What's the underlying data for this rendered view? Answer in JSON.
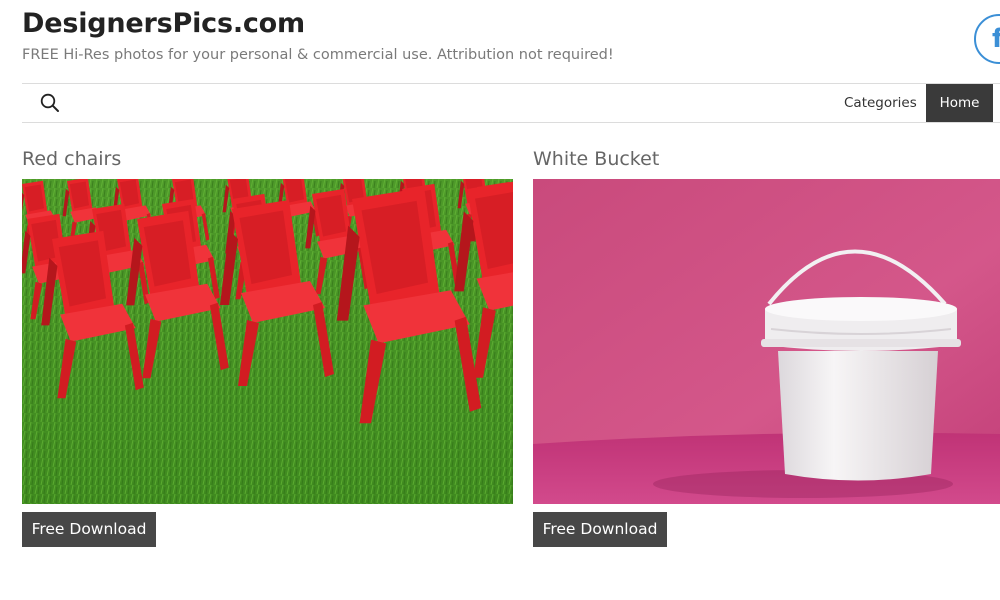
{
  "site": {
    "title": "DesignersPics.com",
    "tagline": "FREE Hi-Res photos for your personal & commercial use. Attribution not required!",
    "social_icon": "facebook-icon"
  },
  "nav": {
    "search_icon": "search-icon",
    "items": [
      {
        "label": "Categories",
        "active": false
      },
      {
        "label": "Home",
        "active": true
      }
    ]
  },
  "posts": [
    {
      "title": "Red chairs",
      "button_label": "Free Download"
    },
    {
      "title": "White Bucket",
      "button_label": "Free Download"
    }
  ],
  "colors": {
    "nav_active_bg": "#3a3a3a",
    "button_bg": "#474747",
    "facebook_blue": "#3b8fd6"
  }
}
